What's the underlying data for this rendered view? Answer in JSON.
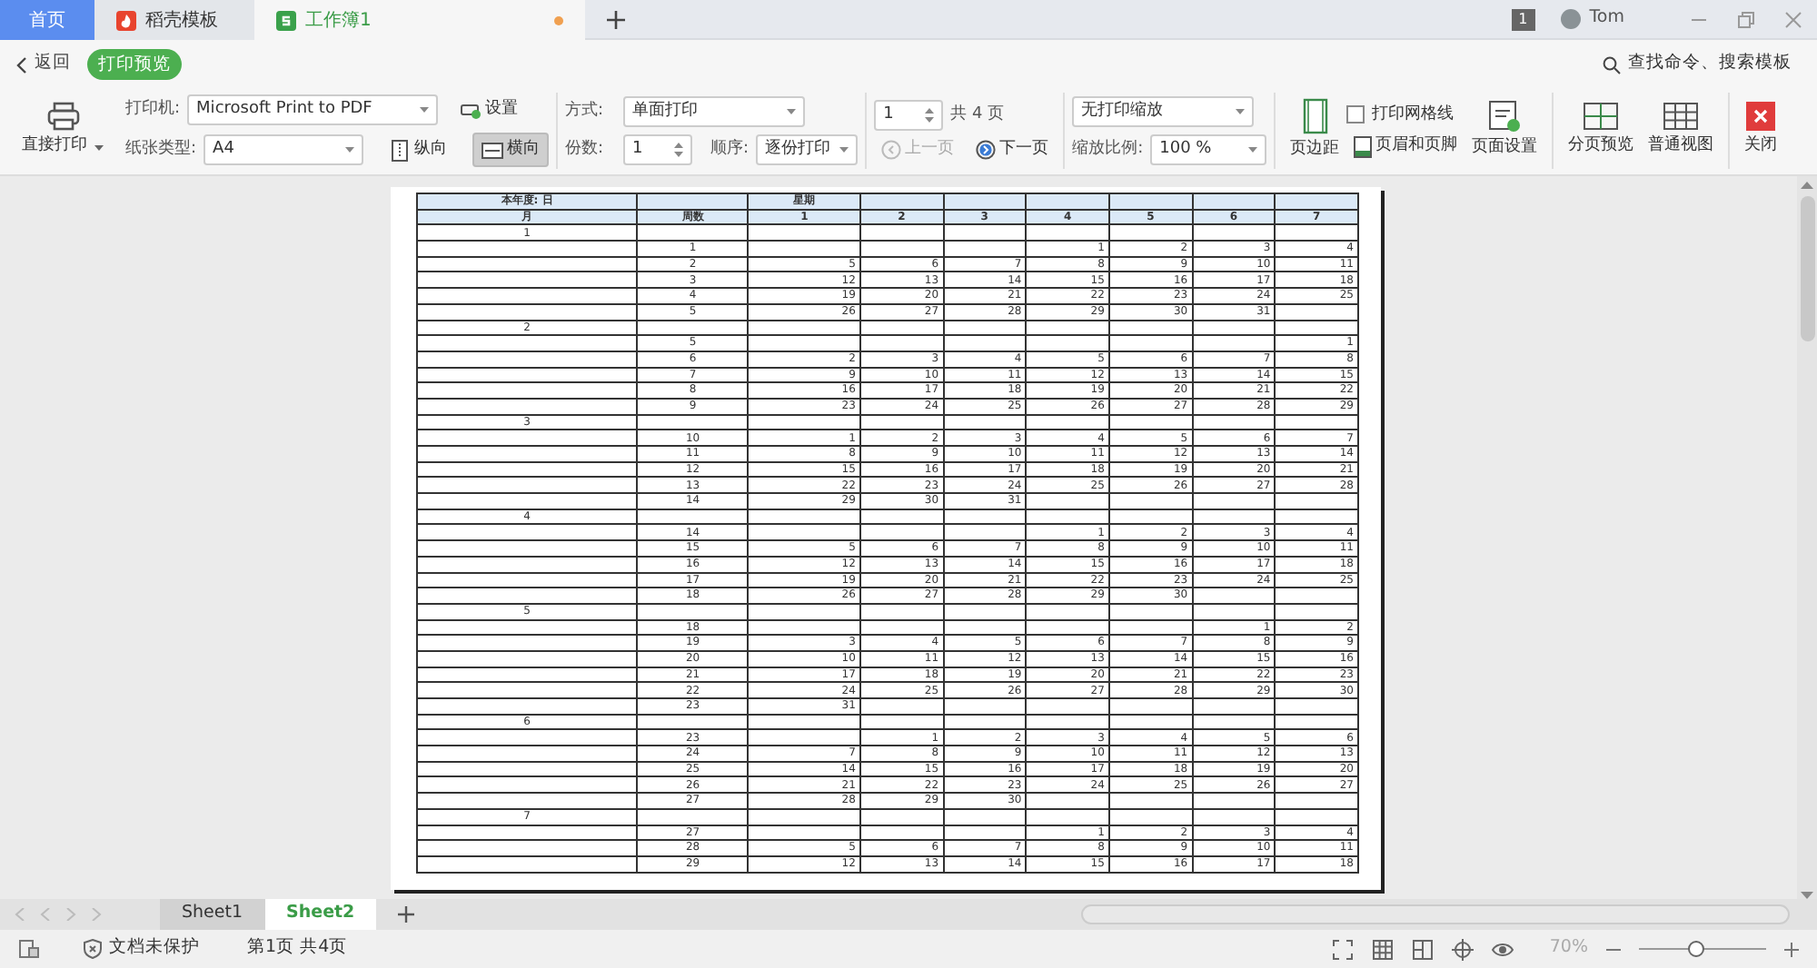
{
  "tabs": [
    {
      "label": "首页",
      "kind": "home",
      "selected": false
    },
    {
      "label": "稻壳模板",
      "kind": "docer",
      "selected": false
    },
    {
      "label": "工作簿1",
      "kind": "sheet",
      "selected": true,
      "modified": true
    }
  ],
  "title_bar": {
    "badge": "1",
    "user": "Tom"
  },
  "toolbar": {
    "back": "返回",
    "mode": "打印预览",
    "search": "查找命令、搜索模板",
    "direct_print": "直接打印",
    "printer_label": "打印机:",
    "printer": "Microsoft Print to PDF",
    "settings": "设置",
    "paper_label": "纸张类型:",
    "paper": "A4",
    "portrait": {
      "label": "纵向",
      "selected": false
    },
    "landscape": {
      "label": "横向",
      "selected": true
    },
    "method_label": "方式:",
    "method": "单面打印",
    "copies_label": "份数:",
    "copies": "1",
    "order_label": "顺序:",
    "order": "逐份打印",
    "page": "1",
    "total": "共 4 页",
    "prev": {
      "label": "上一页",
      "disabled": true
    },
    "next": {
      "label": "下一页",
      "disabled": false
    },
    "scaling": "无打印缩放",
    "scale_label": "缩放比例:",
    "scale": "100 %",
    "margins": "页边距",
    "gridlines": {
      "label": "打印网格线",
      "checked": false
    },
    "header_footer": "页眉和页脚",
    "page_setup": "页面设置",
    "page_break": "分页预览",
    "normal_view": "普通视图",
    "close": "关闭"
  },
  "sheet": {
    "header_1": {
      "title": "本年度: 日",
      "weekday": "星期"
    },
    "header_2": {
      "month": "月",
      "week": "周数",
      "days": [
        "1",
        "2",
        "3",
        "4",
        "5",
        "6",
        "7"
      ]
    },
    "months": [
      {
        "month": "1",
        "weeks": [
          {
            "week": "1",
            "days": {
              "4": "1",
              "5": "2",
              "6": "3",
              "7": "4"
            }
          },
          {
            "week": "2",
            "days": {
              "1": "5",
              "2": "6",
              "3": "7",
              "4": "8",
              "5": "9",
              "6": "10",
              "7": "11"
            }
          },
          {
            "week": "3",
            "days": {
              "1": "12",
              "2": "13",
              "3": "14",
              "4": "15",
              "5": "16",
              "6": "17",
              "7": "18"
            }
          },
          {
            "week": "4",
            "days": {
              "1": "19",
              "2": "20",
              "3": "21",
              "4": "22",
              "5": "23",
              "6": "24",
              "7": "25"
            }
          },
          {
            "week": "5",
            "days": {
              "1": "26",
              "2": "27",
              "3": "28",
              "4": "29",
              "5": "30",
              "6": "31"
            }
          }
        ]
      },
      {
        "month": "2",
        "weeks": [
          {
            "week": "5",
            "days": {
              "7": "1"
            }
          },
          {
            "week": "6",
            "days": {
              "1": "2",
              "2": "3",
              "3": "4",
              "4": "5",
              "5": "6",
              "6": "7",
              "7": "8"
            }
          },
          {
            "week": "7",
            "days": {
              "1": "9",
              "2": "10",
              "3": "11",
              "4": "12",
              "5": "13",
              "6": "14",
              "7": "15"
            }
          },
          {
            "week": "8",
            "days": {
              "1": "16",
              "2": "17",
              "3": "18",
              "4": "19",
              "5": "20",
              "6": "21",
              "7": "22"
            }
          },
          {
            "week": "9",
            "days": {
              "1": "23",
              "2": "24",
              "3": "25",
              "4": "26",
              "5": "27",
              "6": "28",
              "7": "29"
            }
          }
        ]
      },
      {
        "month": "3",
        "weeks": [
          {
            "week": "10",
            "days": {
              "1": "1",
              "2": "2",
              "3": "3",
              "4": "4",
              "5": "5",
              "6": "6",
              "7": "7"
            }
          },
          {
            "week": "11",
            "days": {
              "1": "8",
              "2": "9",
              "3": "10",
              "4": "11",
              "5": "12",
              "6": "13",
              "7": "14"
            }
          },
          {
            "week": "12",
            "days": {
              "1": "15",
              "2": "16",
              "3": "17",
              "4": "18",
              "5": "19",
              "6": "20",
              "7": "21"
            }
          },
          {
            "week": "13",
            "days": {
              "1": "22",
              "2": "23",
              "3": "24",
              "4": "25",
              "5": "26",
              "6": "27",
              "7": "28"
            }
          },
          {
            "week": "14",
            "days": {
              "1": "29",
              "2": "30",
              "3": "31"
            }
          }
        ]
      },
      {
        "month": "4",
        "weeks": [
          {
            "week": "14",
            "days": {
              "4": "1",
              "5": "2",
              "6": "3",
              "7": "4"
            }
          },
          {
            "week": "15",
            "days": {
              "1": "5",
              "2": "6",
              "3": "7",
              "4": "8",
              "5": "9",
              "6": "10",
              "7": "11"
            }
          },
          {
            "week": "16",
            "days": {
              "1": "12",
              "2": "13",
              "3": "14",
              "4": "15",
              "5": "16",
              "6": "17",
              "7": "18"
            }
          },
          {
            "week": "17",
            "days": {
              "1": "19",
              "2": "20",
              "3": "21",
              "4": "22",
              "5": "23",
              "6": "24",
              "7": "25"
            }
          },
          {
            "week": "18",
            "days": {
              "1": "26",
              "2": "27",
              "3": "28",
              "4": "29",
              "5": "30"
            }
          }
        ]
      },
      {
        "month": "5",
        "weeks": [
          {
            "week": "18",
            "days": {
              "6": "1",
              "7": "2"
            }
          },
          {
            "week": "19",
            "days": {
              "1": "3",
              "2": "4",
              "3": "5",
              "4": "6",
              "5": "7",
              "6": "8",
              "7": "9"
            }
          },
          {
            "week": "20",
            "days": {
              "1": "10",
              "2": "11",
              "3": "12",
              "4": "13",
              "5": "14",
              "6": "15",
              "7": "16"
            }
          },
          {
            "week": "21",
            "days": {
              "1": "17",
              "2": "18",
              "3": "19",
              "4": "20",
              "5": "21",
              "6": "22",
              "7": "23"
            }
          },
          {
            "week": "22",
            "days": {
              "1": "24",
              "2": "25",
              "3": "26",
              "4": "27",
              "5": "28",
              "6": "29",
              "7": "30"
            }
          },
          {
            "week": "23",
            "days": {
              "1": "31"
            }
          }
        ]
      },
      {
        "month": "6",
        "weeks": [
          {
            "week": "23",
            "days": {
              "2": "1",
              "3": "2",
              "4": "3",
              "5": "4",
              "6": "5",
              "7": "6"
            }
          },
          {
            "week": "24",
            "days": {
              "1": "7",
              "2": "8",
              "3": "9",
              "4": "10",
              "5": "11",
              "6": "12",
              "7": "13"
            }
          },
          {
            "week": "25",
            "days": {
              "1": "14",
              "2": "15",
              "3": "16",
              "4": "17",
              "5": "18",
              "6": "19",
              "7": "20"
            }
          },
          {
            "week": "26",
            "days": {
              "1": "21",
              "2": "22",
              "3": "23",
              "4": "24",
              "5": "25",
              "6": "26",
              "7": "27"
            }
          },
          {
            "week": "27",
            "days": {
              "1": "28",
              "2": "29",
              "3": "30"
            }
          }
        ]
      },
      {
        "month": "7",
        "weeks": [
          {
            "week": "27",
            "days": {
              "4": "1",
              "5": "2",
              "6": "3",
              "7": "4"
            }
          },
          {
            "week": "28",
            "days": {
              "1": "5",
              "2": "6",
              "3": "7",
              "4": "8",
              "5": "9",
              "6": "10",
              "7": "11"
            }
          },
          {
            "week": "29",
            "days": {
              "1": "12",
              "2": "13",
              "3": "14",
              "4": "15",
              "5": "16",
              "6": "17",
              "7": "18"
            }
          }
        ]
      }
    ]
  },
  "sheet_tabs": [
    {
      "label": "Sheet1",
      "selected": false
    },
    {
      "label": "Sheet2",
      "selected": true
    }
  ],
  "status_bar": {
    "protection": "文档未保护",
    "pages": "第1页 共4页",
    "zoom": "70%",
    "zoom_slider": {
      "level": 0.45
    }
  }
}
